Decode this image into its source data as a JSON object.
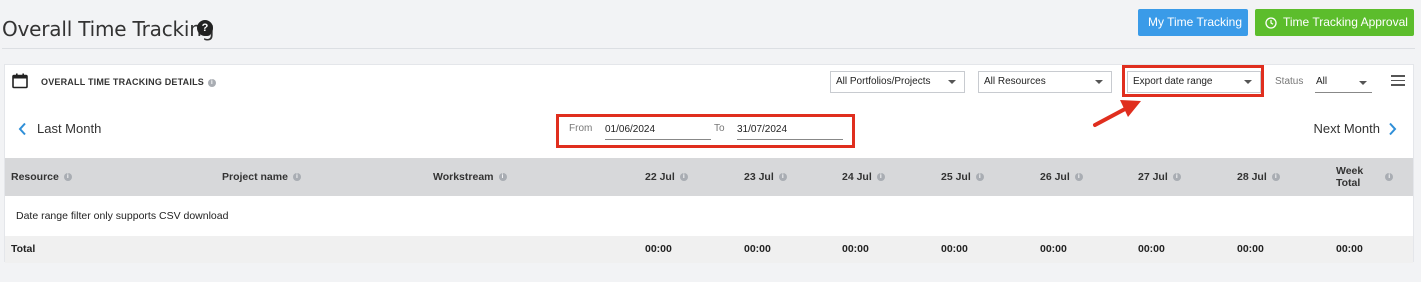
{
  "page": {
    "title": "Overall Time Tracking",
    "help_glyph": "?"
  },
  "actions": {
    "my_time_tracking": "My Time Tracking",
    "time_tracking_approval": "Time Tracking Approval"
  },
  "panel": {
    "title": "OVERALL TIME TRACKING DETAILS",
    "info_glyph": "i",
    "filters": {
      "portfolio": "All Portfolios/Projects",
      "resources": "All Resources",
      "export": "Export date range",
      "status_label": "Status",
      "status_value": "All"
    },
    "nav": {
      "prev": "Last Month",
      "next": "Next Month"
    },
    "date_range": {
      "from_label": "From",
      "from_value": "01/06/2024",
      "to_label": "To",
      "to_value": "31/07/2024"
    }
  },
  "table": {
    "headers": {
      "resource": "Resource",
      "project": "Project name",
      "workstream": "Workstream",
      "d1": "22 Jul",
      "d2": "23 Jul",
      "d3": "24 Jul",
      "d4": "25 Jul",
      "d5": "26 Jul",
      "d6": "27 Jul",
      "d7": "28 Jul",
      "week_line1": "Week",
      "week_line2": "Total"
    },
    "empty_message": "Date range filter only supports CSV download",
    "total": {
      "label": "Total",
      "d1": "00:00",
      "d2": "00:00",
      "d3": "00:00",
      "d4": "00:00",
      "d5": "00:00",
      "d6": "00:00",
      "d7": "00:00",
      "week": "00:00"
    }
  },
  "colors": {
    "primary_blue": "#3a9be8",
    "approval_green": "#5cbd2c",
    "annotation_red": "#e02e1e",
    "nav_arrow": "#2f8fd8"
  },
  "icons": {
    "calendar": "calendar-icon",
    "clock": "clock-icon",
    "menu": "hamburger-menu-icon",
    "prev": "chevron-left-icon",
    "next": "chevron-right-icon",
    "annotation": "red-arrow-icon"
  }
}
